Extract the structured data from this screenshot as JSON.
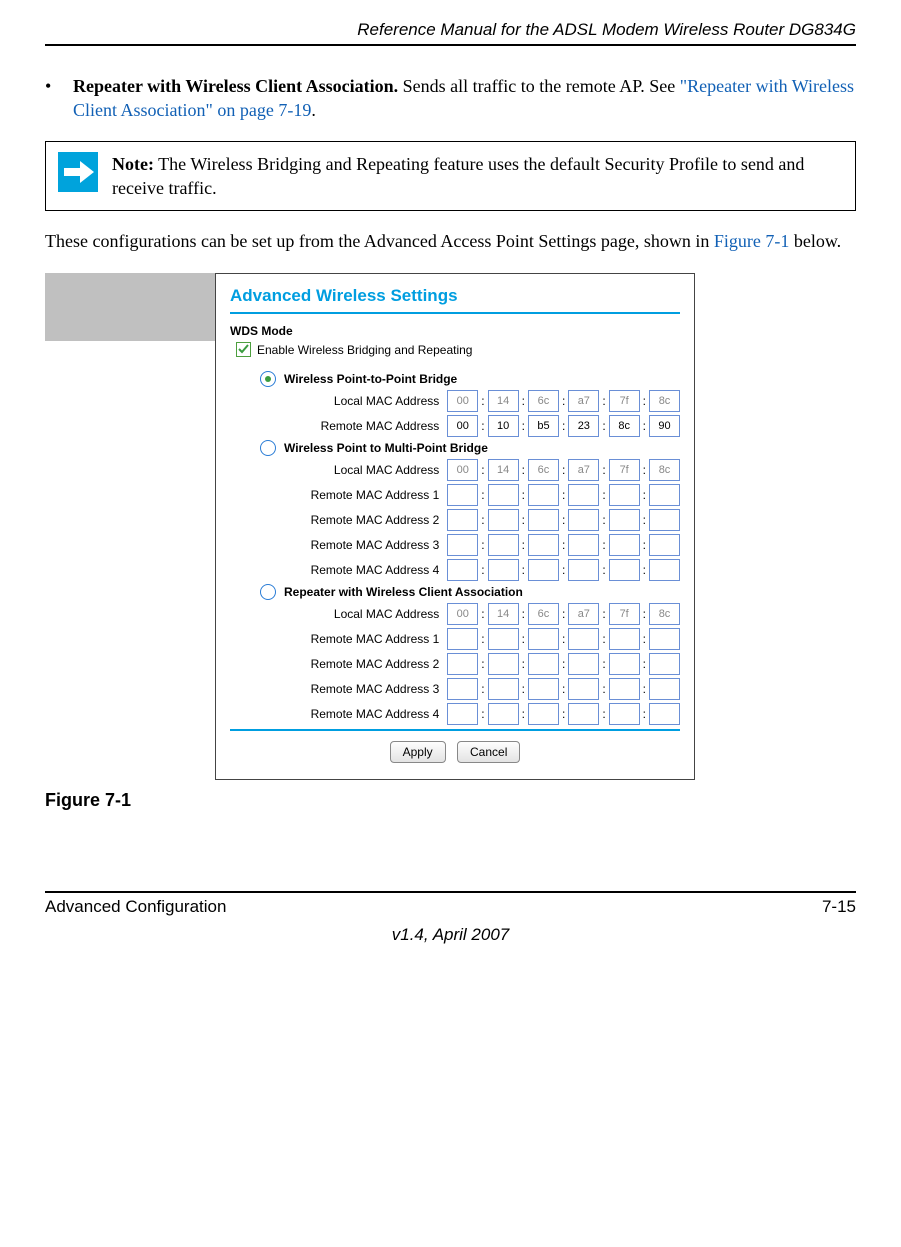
{
  "header": {
    "title": "Reference Manual for the ADSL Modem Wireless Router DG834G"
  },
  "bullet": {
    "marker": "•",
    "bold": "Repeater with Wireless Client Association.",
    "rest": " Sends all traffic to the remote AP. See ",
    "link": "\"Repeater with Wireless Client Association\" on page 7-19",
    "tail": "."
  },
  "note": {
    "label": "Note:",
    "text": " The Wireless Bridging and Repeating feature uses the default Security Profile to send and receive traffic."
  },
  "para": {
    "lead": "These configurations can be set up from the Advanced Access Point Settings page, shown in ",
    "link": "Figure 7-1",
    "tail": " below."
  },
  "figure": {
    "caption": "Figure 7-1"
  },
  "footer": {
    "left": "Advanced Configuration",
    "right": "7-15",
    "version": "v1.4, April 2007"
  },
  "panel": {
    "title": "Advanced Wireless Settings",
    "wds": "WDS Mode",
    "enable": "Enable Wireless Bridging and Repeating",
    "modes": {
      "ptp": "Wireless Point-to-Point Bridge",
      "ptmp": "Wireless Point to Multi-Point Bridge",
      "rep": "Repeater with Wireless Client Association"
    },
    "labels": {
      "local": "Local MAC Address",
      "remote": "Remote MAC Address",
      "remote1": "Remote MAC Address 1",
      "remote2": "Remote MAC Address 2",
      "remote3": "Remote MAC Address 3",
      "remote4": "Remote MAC Address 4"
    },
    "local_mac": [
      "00",
      "14",
      "6c",
      "a7",
      "7f",
      "8c"
    ],
    "remote_mac_ptp": [
      "00",
      "10",
      "b5",
      "23",
      "8c",
      "90"
    ],
    "buttons": {
      "apply": "Apply",
      "cancel": "Cancel"
    }
  }
}
